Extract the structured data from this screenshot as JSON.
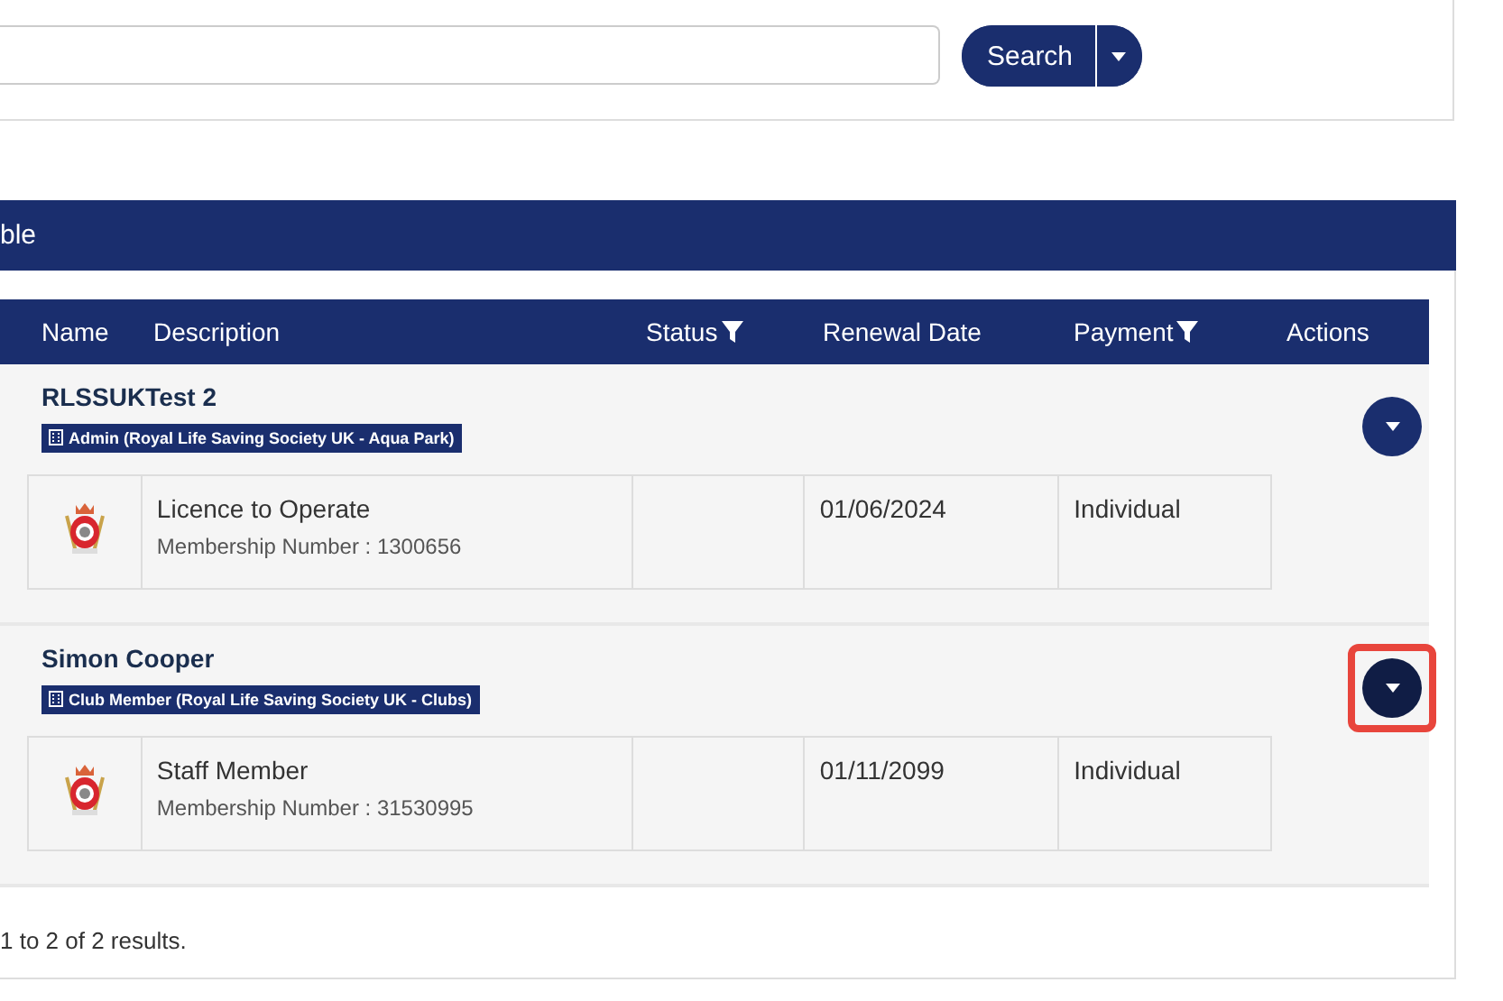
{
  "search_form": {
    "button": "Search"
  },
  "panel": {
    "title": "ble"
  },
  "table": {
    "columns": [
      {
        "label": "Name",
        "filter": false
      },
      {
        "label": "Description",
        "filter": false
      },
      {
        "label": "Status",
        "filter": true
      },
      {
        "label": "Renewal Date",
        "filter": false
      },
      {
        "label": "Payment",
        "filter": true
      },
      {
        "label": "Actions",
        "filter": false
      }
    ],
    "rows": [
      {
        "name": "RLSSUKTest 2",
        "role": "Admin (Royal Life Saving Society UK - Aqua Park)",
        "membership": "Licence to Operate",
        "number": "Membership Number : 1300656",
        "renewal_date": "01/06/2024",
        "payment": "Individual",
        "highlighted": false
      },
      {
        "name": "Simon Cooper",
        "role": "Club Member (Royal Life Saving Society UK - Clubs)",
        "membership": "Staff Member",
        "number": "Membership Number : 31530995",
        "renewal_date": "01/11/2099",
        "payment": "Individual",
        "highlighted": true
      }
    ]
  },
  "results": "1 to 2 of 2 results."
}
